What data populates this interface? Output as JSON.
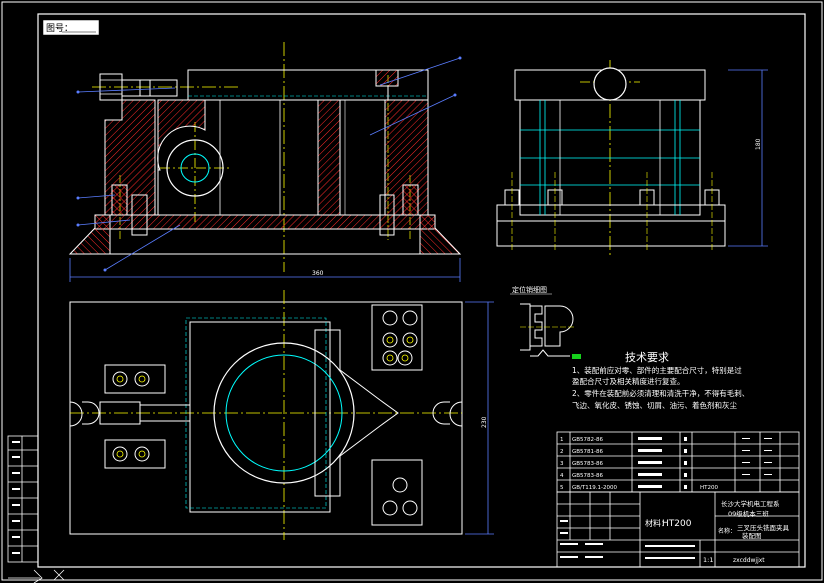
{
  "colors": {
    "background": "#000000",
    "frame": "#ffffff",
    "hatch": "#ff2a2a",
    "outline": "#ffffff",
    "centerline": "#ffff00",
    "hidden": "#00ffff",
    "dimension": "#5a7dff",
    "note_marker": "#16d11c"
  },
  "header": {
    "label": "图号："
  },
  "views": {
    "detail_title": "定位销细图"
  },
  "notes": {
    "title": "技术要求",
    "line1": "1、装配前应对零、部件的主要配合尺寸，特别是过",
    "line2": "盈配合尺寸及相关精度进行复查。",
    "line3": "2、零件在装配前必须清理和清洗干净，不得有毛刺、",
    "line4": "飞边、氧化皮、锈蚀、切屑、油污、着色剂和灰尘"
  },
  "dimensions": {
    "overall_length": "360",
    "side_height": "180",
    "plan_width": "230"
  },
  "bom": {
    "rows": [
      {
        "code": "GB5782-86",
        "seq": "1"
      },
      {
        "code": "GB5781-86",
        "seq": "2"
      },
      {
        "code": "GB5783-86",
        "seq": "3"
      },
      {
        "code": "GB5783-86",
        "seq": "4"
      },
      {
        "code": "GB/T119.1-2000",
        "seq": "5",
        "material": "HT200"
      }
    ]
  },
  "title_block": {
    "material_label": "材料：",
    "material_value": "HT200",
    "school_line1": "长沙大学机电工程系",
    "school_line2": "09级机本三班",
    "name_label": "名称：",
    "part_name_line1": "三叉压头铣面夹具",
    "part_name_line2": "装配图",
    "scale": "1:1",
    "drawing_no": "zxcddwjjxt"
  }
}
